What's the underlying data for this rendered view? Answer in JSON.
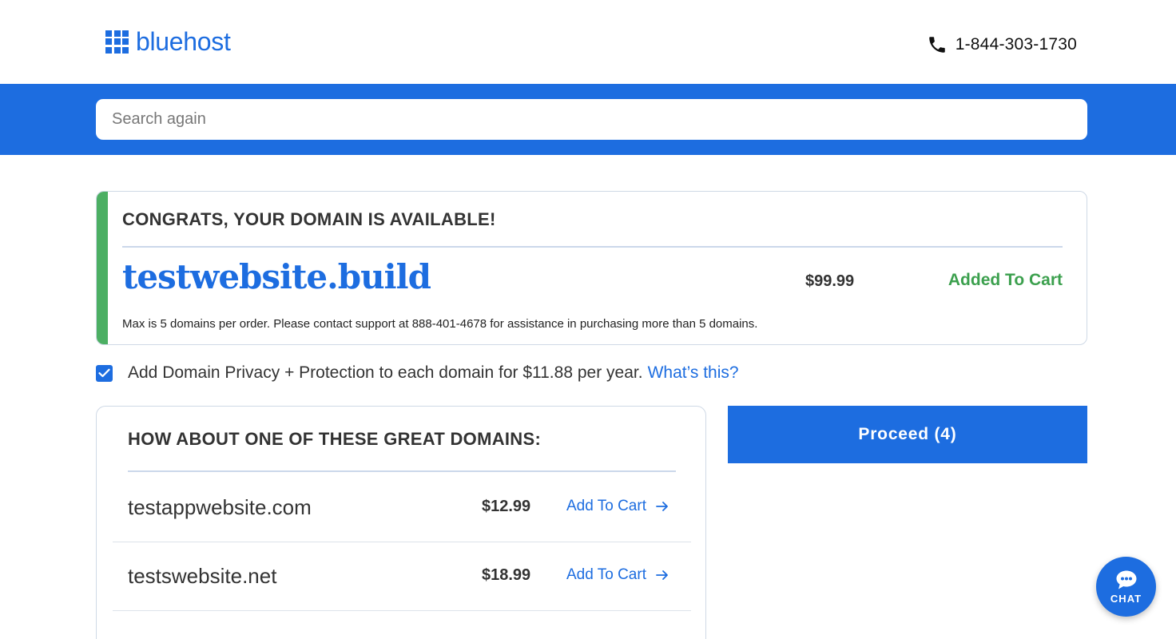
{
  "header": {
    "logo_text": "bluehost",
    "phone": "1-844-303-1730"
  },
  "search": {
    "placeholder": "Search again"
  },
  "result": {
    "heading": "CONGRATS, YOUR DOMAIN IS AVAILABLE!",
    "domain": "testwebsite.build",
    "price": "$99.99",
    "status": "Added To Cart",
    "note": "Max is 5 domains per order. Please contact support at 888-401-4678 for assistance in purchasing more than 5 domains."
  },
  "privacy": {
    "checked": true,
    "text": "Add Domain Privacy + Protection to each domain for $11.88 per year.",
    "link": "What’s this?"
  },
  "suggestions": {
    "title": "HOW ABOUT ONE OF THESE GREAT DOMAINS:",
    "items": [
      {
        "name": "testappwebsite.com",
        "price": "$12.99",
        "action": "Add To Cart"
      },
      {
        "name": "testswebsite.net",
        "price": "$18.99",
        "action": "Add To Cart"
      }
    ]
  },
  "proceed": {
    "label": "Proceed (4)"
  },
  "chat": {
    "label": "CHAT"
  },
  "colors": {
    "brand_blue": "#1d6de0",
    "success_green": "#3ca04e",
    "accent_green": "#4caf63"
  }
}
